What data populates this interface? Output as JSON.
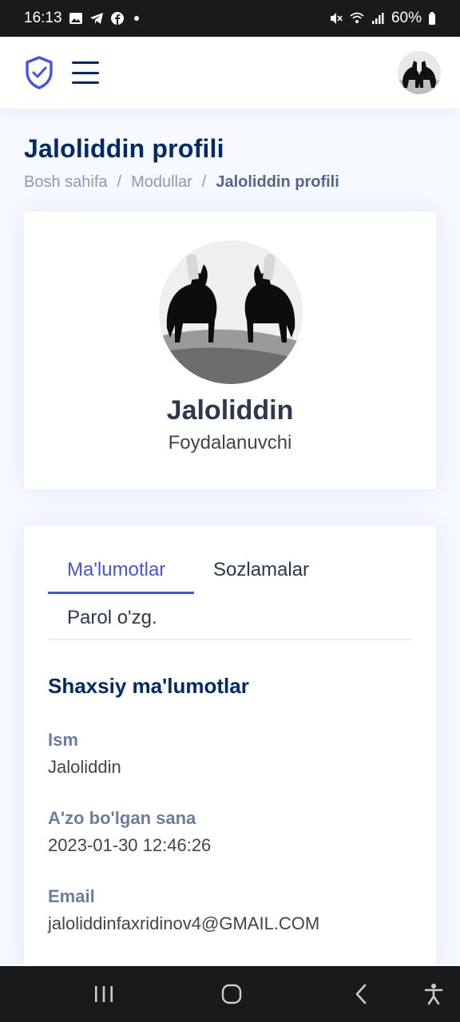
{
  "status_bar": {
    "time": "16:13",
    "battery": "60%"
  },
  "header": {
    "logo_icon": "shield-check-icon",
    "menu_icon": "hamburger-icon"
  },
  "page": {
    "title": "Jaloliddin profili",
    "breadcrumb": [
      "Bosh sahifa",
      "/",
      "Modullar",
      "/",
      "Jaloliddin profili"
    ]
  },
  "profile": {
    "name": "Jaloliddin",
    "role": "Foydalanuvchi"
  },
  "tabs": [
    {
      "label": "Ma'lumotlar",
      "active": true
    },
    {
      "label": "Sozlamalar",
      "active": false
    },
    {
      "label": "Parol o'zg.",
      "active": false
    }
  ],
  "details": {
    "section_title": "Shaxsiy ma'lumotlar",
    "fields": [
      {
        "label": "Ism",
        "value": "Jaloliddin"
      },
      {
        "label": "A'zo bo'lgan sana",
        "value": "2023-01-30 12:46:26"
      },
      {
        "label": "Email",
        "value": "jaloliddinfaxridinov4@GMAIL.COM"
      }
    ]
  },
  "colors": {
    "brand": "#012970",
    "accent": "#4154f1",
    "background": "#f6f9ff"
  }
}
